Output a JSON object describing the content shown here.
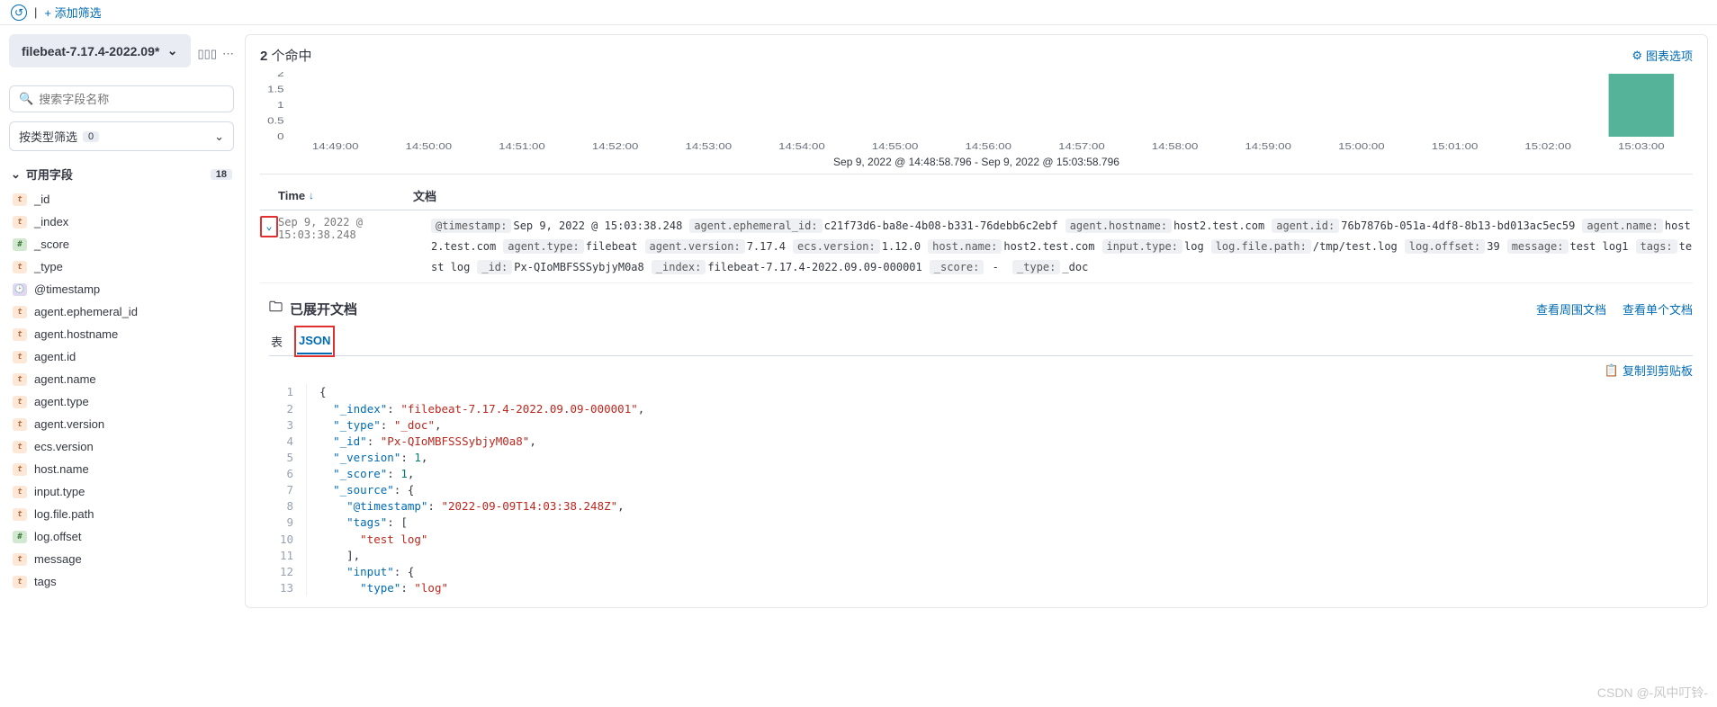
{
  "topbar": {
    "add_filter": "+ 添加筛选"
  },
  "sidebar": {
    "index_pattern": "filebeat-7.17.4-2022.09*",
    "search_placeholder": "搜索字段名称",
    "type_filter_label": "按类型筛选",
    "type_filter_count": "0",
    "available_fields_label": "可用字段",
    "available_fields_count": "18",
    "fields": [
      {
        "type": "t",
        "name": "_id"
      },
      {
        "type": "t",
        "name": "_index"
      },
      {
        "type": "n",
        "name": "_score"
      },
      {
        "type": "t",
        "name": "_type"
      },
      {
        "type": "d",
        "name": "@timestamp"
      },
      {
        "type": "t",
        "name": "agent.ephemeral_id"
      },
      {
        "type": "t",
        "name": "agent.hostname"
      },
      {
        "type": "t",
        "name": "agent.id"
      },
      {
        "type": "t",
        "name": "agent.name"
      },
      {
        "type": "t",
        "name": "agent.type"
      },
      {
        "type": "t",
        "name": "agent.version"
      },
      {
        "type": "t",
        "name": "ecs.version"
      },
      {
        "type": "t",
        "name": "host.name"
      },
      {
        "type": "t",
        "name": "input.type"
      },
      {
        "type": "t",
        "name": "log.file.path"
      },
      {
        "type": "n",
        "name": "log.offset"
      },
      {
        "type": "t",
        "name": "message"
      },
      {
        "type": "t",
        "name": "tags"
      }
    ]
  },
  "main": {
    "hits_count": "2",
    "hits_suffix": " 个命中",
    "chart_options": "图表选项",
    "time_range_label": "Sep 9, 2022 @ 14:48:58.796 - Sep 9, 2022 @ 15:03:58.796",
    "col_time": "Time",
    "col_doc": "文档"
  },
  "chart_data": {
    "type": "bar",
    "ylim": [
      0,
      2
    ],
    "yticks": [
      0,
      0.5,
      1,
      1.5,
      2
    ],
    "categories": [
      "14:49:00",
      "14:50:00",
      "14:51:00",
      "14:52:00",
      "14:53:00",
      "14:54:00",
      "14:55:00",
      "14:56:00",
      "14:57:00",
      "14:58:00",
      "14:59:00",
      "15:00:00",
      "15:01:00",
      "15:02:00",
      "15:03:00"
    ],
    "values": [
      0,
      0,
      0,
      0,
      0,
      0,
      0,
      0,
      0,
      0,
      0,
      0,
      0,
      0,
      2
    ],
    "xlabel": "Sep 9, 2022 @ 14:48:58.796 - Sep 9, 2022 @ 15:03:58.796"
  },
  "doc": {
    "time_value": "Sep 9, 2022 @ 15:03:38.248",
    "kv": [
      {
        "k": "@timestamp:",
        "v": "Sep 9, 2022 @ 15:03:38.248"
      },
      {
        "k": "agent.ephemeral_id:",
        "v": "c21f73d6-ba8e-4b08-b331-76debb6c2ebf"
      },
      {
        "k": "agent.hostname:",
        "v": "host2.test.com"
      },
      {
        "k": "agent.id:",
        "v": "76b7876b-051a-4df8-8b13-bd013ac5ec59"
      },
      {
        "k": "agent.name:",
        "v": "host2.test.com"
      },
      {
        "k": "agent.type:",
        "v": "filebeat"
      },
      {
        "k": "agent.version:",
        "v": "7.17.4"
      },
      {
        "k": "ecs.version:",
        "v": "1.12.0"
      },
      {
        "k": "host.name:",
        "v": "host2.test.com"
      },
      {
        "k": "input.type:",
        "v": "log"
      },
      {
        "k": "log.file.path:",
        "v": "/tmp/test.log"
      },
      {
        "k": "log.offset:",
        "v": "39"
      },
      {
        "k": "message:",
        "v": "test log1"
      },
      {
        "k": "tags:",
        "v": "test log"
      },
      {
        "k": "_id:",
        "v": "Px-QIoMBFSSSybjyM0a8"
      },
      {
        "k": "_index:",
        "v": "filebeat-7.17.4-2022.09.09-000001"
      },
      {
        "k": "_score:",
        "v": " - "
      },
      {
        "k": "_type:",
        "v": "_doc"
      }
    ]
  },
  "expanded": {
    "title": "已展开文档",
    "link_surrounding": "查看周围文档",
    "link_single": "查看单个文档",
    "tab_table": "表",
    "tab_json": "JSON",
    "copy_label": "复制到剪贴板",
    "json_lines": [
      [
        {
          "t": "p",
          "v": "{"
        }
      ],
      [
        {
          "t": "p",
          "v": "  "
        },
        {
          "t": "k",
          "v": "\"_index\""
        },
        {
          "t": "p",
          "v": ": "
        },
        {
          "t": "s",
          "v": "\"filebeat-7.17.4-2022.09.09-000001\""
        },
        {
          "t": "p",
          "v": ","
        }
      ],
      [
        {
          "t": "p",
          "v": "  "
        },
        {
          "t": "k",
          "v": "\"_type\""
        },
        {
          "t": "p",
          "v": ": "
        },
        {
          "t": "s",
          "v": "\"_doc\""
        },
        {
          "t": "p",
          "v": ","
        }
      ],
      [
        {
          "t": "p",
          "v": "  "
        },
        {
          "t": "k",
          "v": "\"_id\""
        },
        {
          "t": "p",
          "v": ": "
        },
        {
          "t": "s",
          "v": "\"Px-QIoMBFSSSybjyM0a8\""
        },
        {
          "t": "p",
          "v": ","
        }
      ],
      [
        {
          "t": "p",
          "v": "  "
        },
        {
          "t": "k",
          "v": "\"_version\""
        },
        {
          "t": "p",
          "v": ": "
        },
        {
          "t": "n",
          "v": "1"
        },
        {
          "t": "p",
          "v": ","
        }
      ],
      [
        {
          "t": "p",
          "v": "  "
        },
        {
          "t": "k",
          "v": "\"_score\""
        },
        {
          "t": "p",
          "v": ": "
        },
        {
          "t": "n",
          "v": "1"
        },
        {
          "t": "p",
          "v": ","
        }
      ],
      [
        {
          "t": "p",
          "v": "  "
        },
        {
          "t": "k",
          "v": "\"_source\""
        },
        {
          "t": "p",
          "v": ": {"
        }
      ],
      [
        {
          "t": "p",
          "v": "    "
        },
        {
          "t": "k",
          "v": "\"@timestamp\""
        },
        {
          "t": "p",
          "v": ": "
        },
        {
          "t": "s",
          "v": "\"2022-09-09T14:03:38.248Z\""
        },
        {
          "t": "p",
          "v": ","
        }
      ],
      [
        {
          "t": "p",
          "v": "    "
        },
        {
          "t": "k",
          "v": "\"tags\""
        },
        {
          "t": "p",
          "v": ": ["
        }
      ],
      [
        {
          "t": "p",
          "v": "      "
        },
        {
          "t": "s",
          "v": "\"test log\""
        }
      ],
      [
        {
          "t": "p",
          "v": "    ],"
        }
      ],
      [
        {
          "t": "p",
          "v": "    "
        },
        {
          "t": "k",
          "v": "\"input\""
        },
        {
          "t": "p",
          "v": ": {"
        }
      ],
      [
        {
          "t": "p",
          "v": "      "
        },
        {
          "t": "k",
          "v": "\"type\""
        },
        {
          "t": "p",
          "v": ": "
        },
        {
          "t": "s",
          "v": "\"log\""
        }
      ]
    ]
  },
  "watermark": "CSDN @-风中叮铃-"
}
